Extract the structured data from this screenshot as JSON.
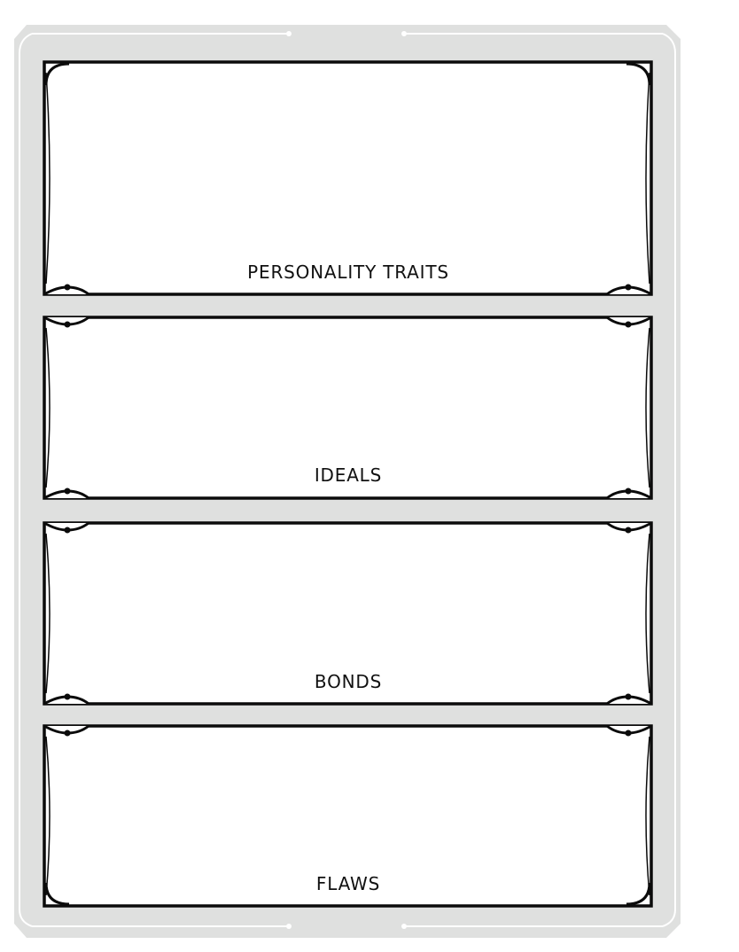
{
  "sheet": {
    "colors": {
      "frame_fill": "#dfe0df",
      "frame_accent": "#ffffff",
      "panel_fill": "#ffffff",
      "panel_stroke": "#0b0b0b"
    },
    "panels": [
      {
        "id": "personality-traits",
        "label": "PERSONALITY TRAITS",
        "value": ""
      },
      {
        "id": "ideals",
        "label": "IDEALS",
        "value": ""
      },
      {
        "id": "bonds",
        "label": "BONDS",
        "value": ""
      },
      {
        "id": "flaws",
        "label": "FLAWS",
        "value": ""
      }
    ]
  }
}
